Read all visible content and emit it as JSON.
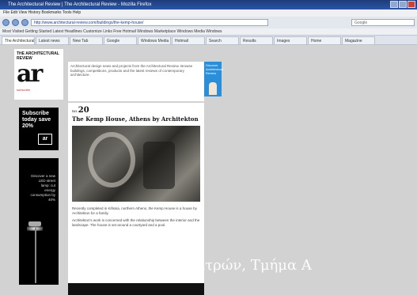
{
  "window": {
    "title": "The Architectural Review | The Architectural Review - Mozilla Firefox"
  },
  "menubar": {
    "items": "File  Edit  View  History  Bookmarks  Tools  Help"
  },
  "navbar": {
    "address": "http://www.architectural-review.com/buildings/the-kemp-house/",
    "search_placeholder": "Google"
  },
  "bookmarks": {
    "text": "Most Visited   Getting Started   Latest Headlines   Customize Links   Free Hotmail   Windows Marketplace   Windows Media   Windows"
  },
  "tabs": [
    {
      "label": "The Architectural..."
    },
    {
      "label": "Latest news"
    },
    {
      "label": "New Tab"
    },
    {
      "label": "Google"
    },
    {
      "label": "Windows Media"
    },
    {
      "label": "Hotmail"
    },
    {
      "label": "Search"
    },
    {
      "label": "Results"
    },
    {
      "label": "Images"
    },
    {
      "label": "Home"
    },
    {
      "label": "Magazine"
    }
  ],
  "sidebar": {
    "logo_small": "THE ARCHITECTURAL REVIEW",
    "logo_big": "ar",
    "logo_sub": "subscribe",
    "subscribe_text": "Subscribe today save 20%",
    "subscribe_mini": "ar",
    "lamp_text": "Discover a new LED street lamp: cut energy consumption by 40%"
  },
  "top_block": {
    "text": "Architectural design news and projects from the Architectural Review. Browse buildings, competitions, products and the latest reviews of contemporary architecture."
  },
  "side_ad": {
    "text": "Discover Architectural Review"
  },
  "article": {
    "number": "20",
    "number_prefix": "no.",
    "headline": "The Kemp House, Athens by Architekton",
    "para1": "Recently completed in Kifissia, northern Athens, the Kemp House is a house by Architekton for a family.",
    "para2": "Architekton's work is concerned with the relationship between the interior and the landscape. The house is set around a courtyard and a pool."
  },
  "overlay": {
    "watermark": "Πανεπιστήμιο Πατρών, Τμήμα Α"
  }
}
